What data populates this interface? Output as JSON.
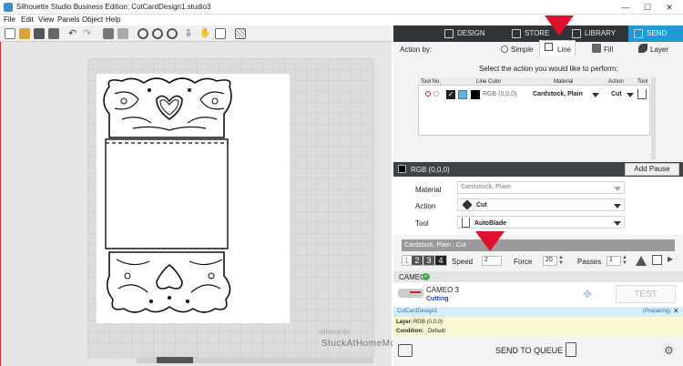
{
  "window": {
    "title": "Silhouette Studio Business Edition: CutCardDesign1.studio3",
    "minimize": "—",
    "maximize": "☐",
    "close": "✕"
  },
  "menu": [
    "File",
    "Edit",
    "View",
    "Panels",
    "Object",
    "Help"
  ],
  "nav_tabs": [
    {
      "label": "DESIGN",
      "icon": "grid-icon"
    },
    {
      "label": "STORE",
      "icon": "store-icon"
    },
    {
      "label": "LIBRARY",
      "icon": "library-icon"
    },
    {
      "label": "SEND",
      "icon": "send-icon"
    }
  ],
  "action_by": {
    "label": "Action by:",
    "options": [
      {
        "label": "Simple"
      },
      {
        "label": "Line"
      },
      {
        "label": "Fill"
      },
      {
        "label": "Layer"
      }
    ],
    "selected": "Line"
  },
  "instruction": "Select the action you would like to perform:",
  "table": {
    "headers": [
      "Tool No.",
      "Line Color",
      "Material",
      "Action",
      "Tool"
    ],
    "rows": [
      {
        "color": "RGB (0,0,0)",
        "material": "Cardstock, Plain",
        "action": "Cut"
      }
    ]
  },
  "color_bar": {
    "label": "RGB (0,0,0)",
    "add_pause": "Add Pause"
  },
  "settings": {
    "material_label": "Material",
    "material_value": "Cardstock, Plain",
    "action_label": "Action",
    "action_value": "Cut",
    "tool_label": "Tool",
    "tool_value": "AutoBlade"
  },
  "cut_settings": {
    "header": "Cardstock, Plain : Cut",
    "blade_steps": [
      "1",
      "2",
      "3",
      "4"
    ],
    "speed_label": "Speed",
    "speed_value": "2",
    "force_label": "Force",
    "force_value": "20",
    "passes_label": "Passes",
    "passes_value": "1"
  },
  "device": {
    "group": "CAMEO",
    "name": "CAMEO 3",
    "status": "Cutting",
    "test": "TEST"
  },
  "job": {
    "name": "CutCardDesign1",
    "state": "(Preparing)",
    "layer_label": "Layer:",
    "layer_value": "RGB (0,0,0)",
    "condition_label": "Condition:",
    "condition_value": "Default"
  },
  "send_to_queue": "SEND TO QUEUE",
  "watermark": "StuckAtHomeMom.com",
  "canvas_brand": "silhouette",
  "colors": {
    "send_tab": "#1e9bd7",
    "nav_bg": "#2e3438",
    "arrow": "#e0112b",
    "cutting": "#1a3fc7",
    "job_bar": "#d6eef9",
    "layer_bg": "#fafad2"
  }
}
